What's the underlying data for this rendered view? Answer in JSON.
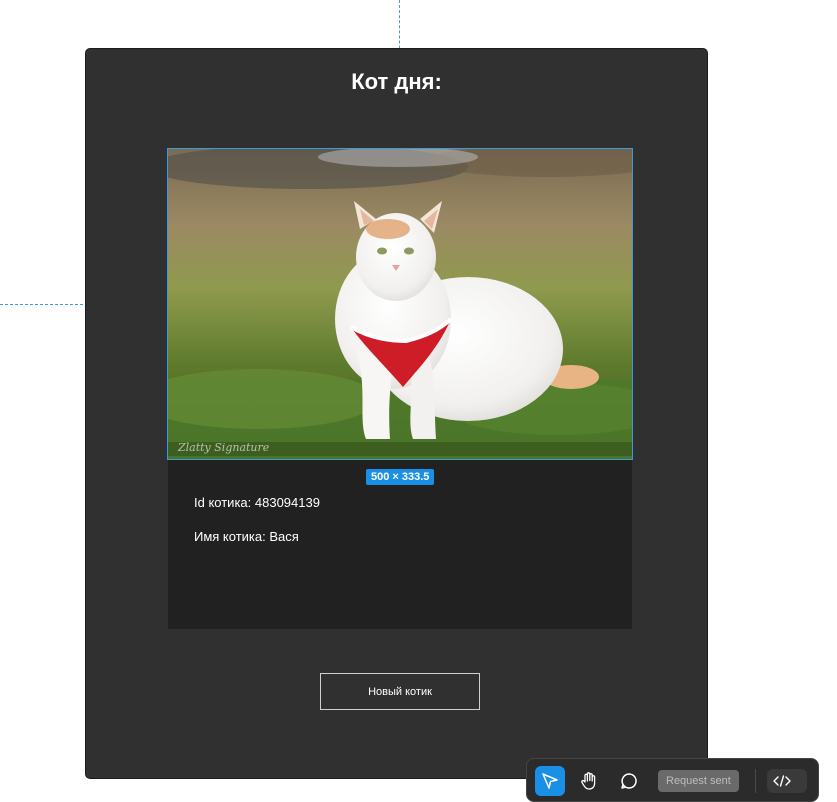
{
  "card": {
    "title": "Кот дня:"
  },
  "cat": {
    "image_alt": "white cat in red harness on grass",
    "image_size_badge": "500 × 333.5",
    "id_line": "Id котика: 483094139",
    "name_line": "Имя котика: Вася"
  },
  "actions": {
    "new_cat_label": "Новый котик"
  },
  "toolbar": {
    "icons": [
      "pointer-icon",
      "hand-icon",
      "comment-icon",
      "code-icon"
    ],
    "request_status": "Request sent"
  },
  "colors": {
    "card_bg": "#303030",
    "inner_bg": "#212121",
    "accent": "#1a8fe6",
    "guide": "#3d9bd9"
  }
}
